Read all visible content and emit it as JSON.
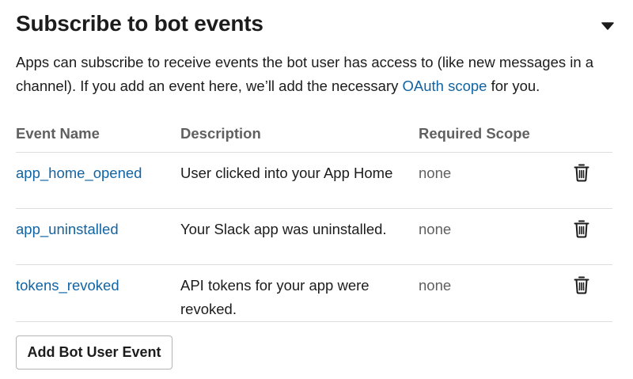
{
  "section": {
    "title": "Subscribe to bot events",
    "toggle_icon": "caret-down-icon",
    "intro_part1": "Apps can subscribe to receive events the bot user has access to (like new messages in a channel). If you add an event here, we’ll add the necessary ",
    "intro_link": "OAuth scope",
    "intro_part2": " for you."
  },
  "table": {
    "columns": [
      "Event Name",
      "Description",
      "Required Scope"
    ],
    "rows": [
      {
        "name": "app_home_opened",
        "description": "User clicked into your App Home",
        "scope": "none"
      },
      {
        "name": "app_uninstalled",
        "description": "Your Slack app was uninstalled.",
        "scope": "none"
      },
      {
        "name": "tokens_revoked",
        "description": "API tokens for your app were revoked.",
        "scope": "none"
      }
    ],
    "delete_icon": "trash-icon"
  },
  "add_button": {
    "label": "Add Bot User Event"
  },
  "colors": {
    "text": "#1d1c1d",
    "muted": "#616061",
    "link": "#1264a3",
    "divider": "#dddddd",
    "button_border": "#b4b4b4"
  }
}
